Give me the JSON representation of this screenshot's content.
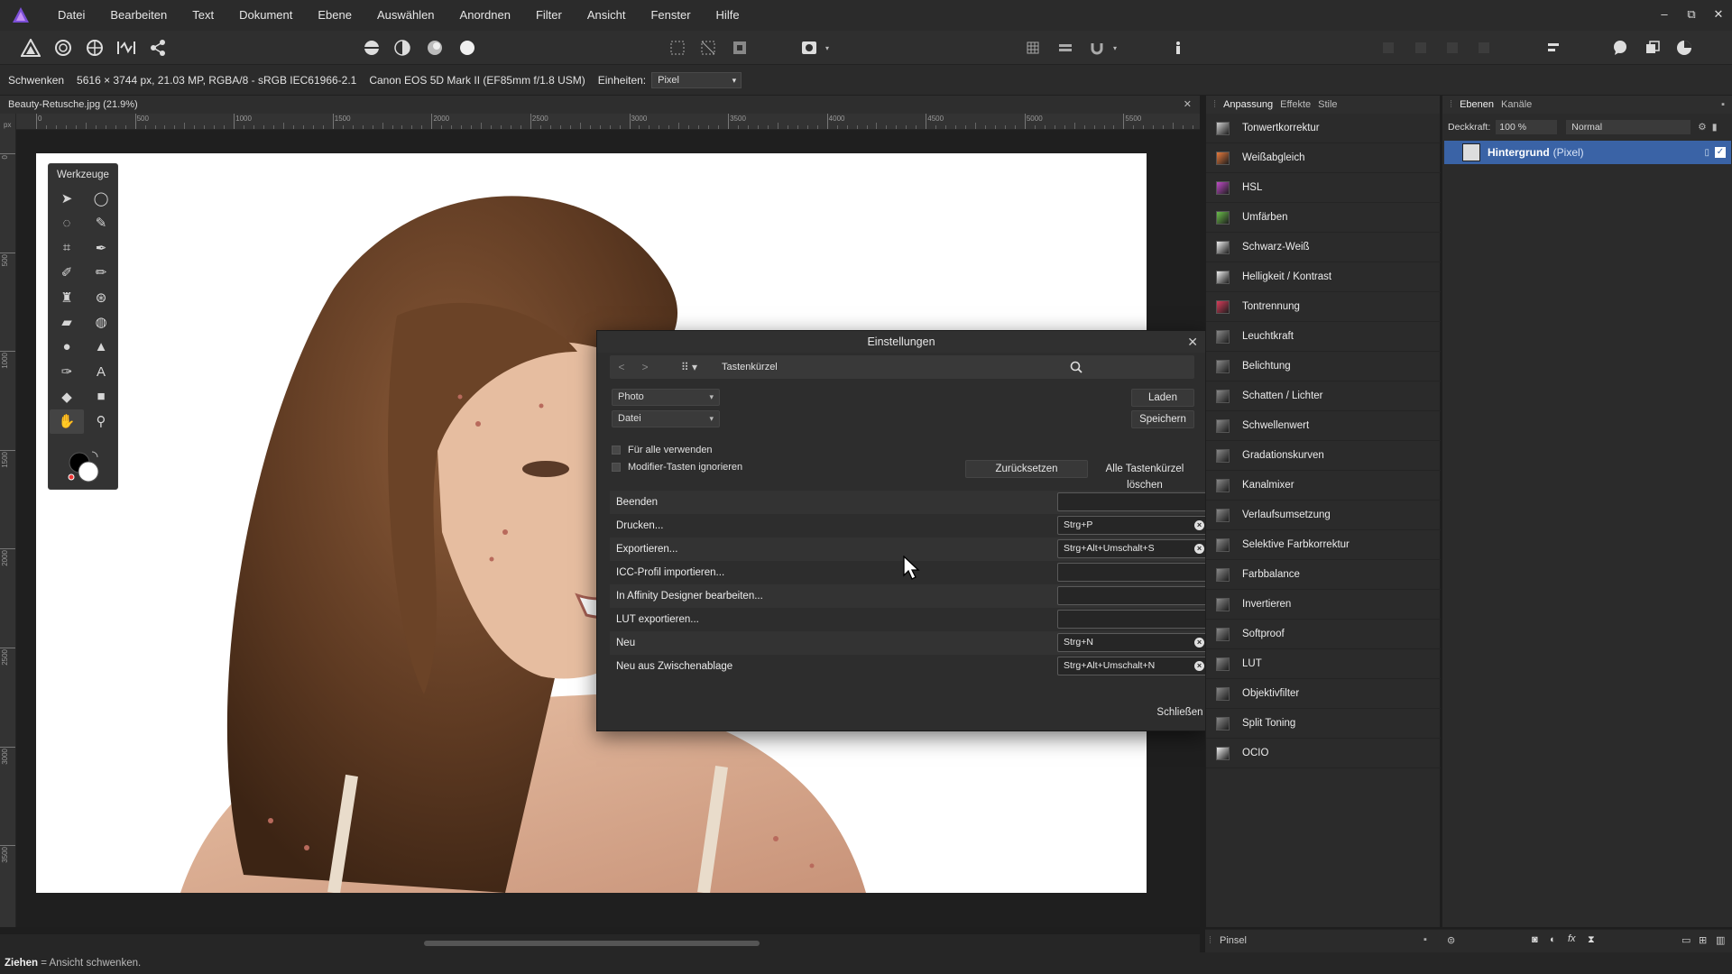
{
  "menubar": {
    "items": [
      "Datei",
      "Bearbeiten",
      "Text",
      "Dokument",
      "Ebene",
      "Auswählen",
      "Anordnen",
      "Filter",
      "Ansicht",
      "Fenster",
      "Hilfe"
    ],
    "window_controls": [
      "–",
      "⧉",
      "✕"
    ]
  },
  "context": {
    "tool_name": "Schwenken",
    "image_info": "5616 × 3744 px, 21.03 MP, RGBA/8 - sRGB IEC61966-2.1",
    "camera": "Canon EOS 5D Mark II (EF85mm f/1.8 USM)",
    "units_label": "Einheiten:",
    "units_value": "Pixel"
  },
  "document": {
    "tab_title": "Beauty-Retusche.jpg (21.9%)",
    "close": "✕"
  },
  "rulers": {
    "unit": "px",
    "h_ticks": [
      "0",
      "500",
      "1000",
      "1500",
      "2000",
      "2500",
      "3000",
      "3500",
      "4000",
      "4500",
      "5000",
      "5500"
    ],
    "v_ticks": [
      "0",
      "500",
      "1000",
      "1500",
      "2000",
      "2500",
      "3000",
      "3500"
    ]
  },
  "tools": {
    "title": "Werkzeuge",
    "items": [
      "move-tool-icon",
      "selection-brush-icon",
      "freehand-selection-icon",
      "flood-select-icon",
      "crop-icon",
      "color-picker-icon",
      "paint-brush-icon",
      "pixel-brush-icon",
      "clone-icon",
      "blemish-remover-icon",
      "erase-icon",
      "dodge-icon",
      "blur-icon",
      "sharpen-icon",
      "pen-icon",
      "text-icon",
      "fill-icon",
      "shape-icon",
      "hand-icon",
      "zoom-icon"
    ]
  },
  "dialog": {
    "title": "Einstellungen",
    "close": "✕",
    "breadcrumb": "Tastenkürzel",
    "dropdown_app": "Photo",
    "dropdown_category": "Datei",
    "btn_load": "Laden",
    "btn_save": "Speichern",
    "chk_all": "Für alle verwenden",
    "chk_modifier": "Modifier-Tasten ignorieren",
    "btn_reset": "Zurücksetzen",
    "btn_clear_all": "Alle Tastenkürzel löschen",
    "btn_close": "Schließen",
    "shortcuts": [
      {
        "label": "Beenden",
        "key": ""
      },
      {
        "label": "Drucken...",
        "key": "Strg+P"
      },
      {
        "label": "Exportieren...",
        "key": "Strg+Alt+Umschalt+S"
      },
      {
        "label": "ICC-Profil importieren...",
        "key": ""
      },
      {
        "label": "In Affinity Designer bearbeiten...",
        "key": ""
      },
      {
        "label": "LUT exportieren...",
        "key": ""
      },
      {
        "label": "Neu",
        "key": "Strg+N"
      },
      {
        "label": "Neu aus Zwischenablage",
        "key": "Strg+Alt+Umschalt+N"
      }
    ]
  },
  "adjustments": {
    "tabs": [
      "Anpassung",
      "Effekte",
      "Stile"
    ],
    "items": [
      {
        "label": "Tonwertkorrektur",
        "color": "#d0d0d0"
      },
      {
        "label": "Weißabgleich",
        "color": "#e87a3c"
      },
      {
        "label": "HSL",
        "color": "#c04bc8"
      },
      {
        "label": "Umfärben",
        "color": "#6bbf4a"
      },
      {
        "label": "Schwarz-Weiß",
        "color": "#f0f0f0"
      },
      {
        "label": "Helligkeit / Kontrast",
        "color": "#f0f0f0"
      },
      {
        "label": "Tontrennung",
        "color": "#d83c5a"
      },
      {
        "label": "Leuchtkraft",
        "color": "#8a8a8a"
      },
      {
        "label": "Belichtung",
        "color": "#8a8a8a"
      },
      {
        "label": "Schatten / Lichter",
        "color": "#8a8a8a"
      },
      {
        "label": "Schwellenwert",
        "color": "#8a8a8a"
      },
      {
        "label": "Gradationskurven",
        "color": "#8a8a8a"
      },
      {
        "label": "Kanalmixer",
        "color": "#8a8a8a"
      },
      {
        "label": "Verlaufsumsetzung",
        "color": "#8a8a8a"
      },
      {
        "label": "Selektive Farbkorrektur",
        "color": "#8a8a8a"
      },
      {
        "label": "Farbbalance",
        "color": "#8a8a8a"
      },
      {
        "label": "Invertieren",
        "color": "#8a8a8a"
      },
      {
        "label": "Softproof",
        "color": "#8a8a8a"
      },
      {
        "label": "LUT",
        "color": "#8a8a8a"
      },
      {
        "label": "Objektivfilter",
        "color": "#8a8a8a"
      },
      {
        "label": "Split Toning",
        "color": "#8a8a8a"
      },
      {
        "label": "OCIO",
        "color": "#f0f0f0"
      }
    ],
    "bottom_label": "Pinsel"
  },
  "layers": {
    "tabs": [
      "Ebenen",
      "Kanäle"
    ],
    "opacity_label": "Deckkraft:",
    "opacity_value": "100 %",
    "blend_mode": "Normal",
    "layer_name": "Hintergrund",
    "layer_type": "(Pixel)"
  },
  "status": {
    "action": "Ziehen",
    "description": "= Ansicht schwenken."
  },
  "colors": {
    "selection": "#3a63a6",
    "accent_logo": "#7b4fd6"
  }
}
